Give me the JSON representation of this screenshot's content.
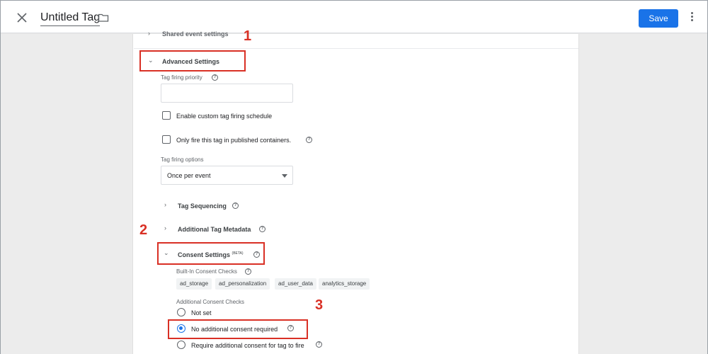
{
  "header": {
    "title": "Untitled Tag",
    "save_label": "Save",
    "close_icon": "close-icon",
    "folder_icon": "folder-icon",
    "more_icon": "more-vert-icon"
  },
  "sections": {
    "shared_event_settings": "Shared event settings",
    "advanced_settings": "Advanced Settings",
    "tag_firing_priority_label": "Tag firing priority",
    "tag_firing_priority_value": "",
    "enable_custom_schedule": "Enable custom tag firing schedule",
    "only_fire_published": "Only fire this tag in published containers.",
    "tag_firing_options_label": "Tag firing options",
    "tag_firing_options_value": "Once per event",
    "tag_sequencing": "Tag Sequencing",
    "additional_tag_metadata": "Additional Tag Metadata",
    "consent_settings": "Consent Settings",
    "consent_beta": "(BETA)",
    "built_in_consent_checks": "Built-In Consent Checks",
    "consent_chips": [
      "ad_storage",
      "ad_personalization",
      "ad_user_data",
      "analytics_storage"
    ],
    "additional_consent_checks": "Additional Consent Checks",
    "radio_options": [
      "Not set",
      "No additional consent required",
      "Require additional consent for tag to fire"
    ],
    "selected_radio": "No additional consent required"
  },
  "annotations": {
    "marker_1": "1",
    "marker_2": "2",
    "marker_3": "3"
  },
  "colors": {
    "accent": "#1a73e8",
    "annotation": "#d93025"
  }
}
